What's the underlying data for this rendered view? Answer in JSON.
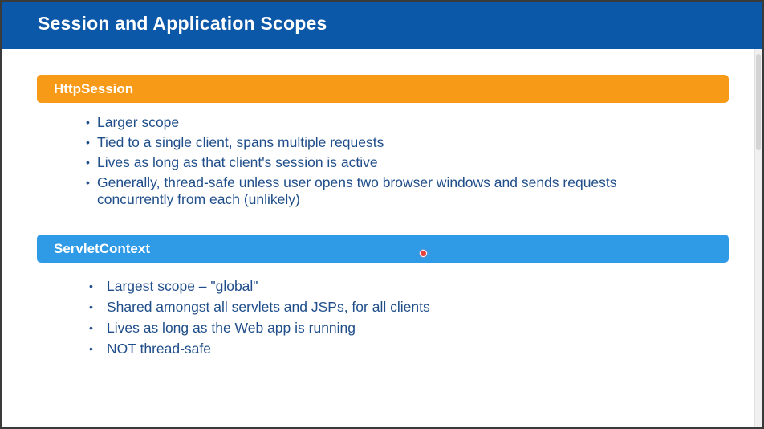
{
  "slide": {
    "title": "Session and Application Scopes"
  },
  "sections": [
    {
      "label": "HttpSession",
      "color": "#f79a18",
      "bullets": [
        "Larger scope",
        "Tied to a single client, spans multiple requests",
        "Lives as long as that client's session is active",
        "Generally, thread-safe unless user opens two browser windows and sends requests concurrently from each (unlikely)"
      ]
    },
    {
      "label": "ServletContext",
      "color": "#2f9ae6",
      "bullets": [
        "Largest scope – \"global\"",
        "Shared amongst all servlets and JSPs, for all clients",
        "Lives as long as the Web app is running",
        "NOT thread-safe"
      ]
    }
  ],
  "colors": {
    "title_bar": "#0b57a8",
    "bullet_text": "#1f4e8a",
    "pointer": "#e8413c"
  }
}
